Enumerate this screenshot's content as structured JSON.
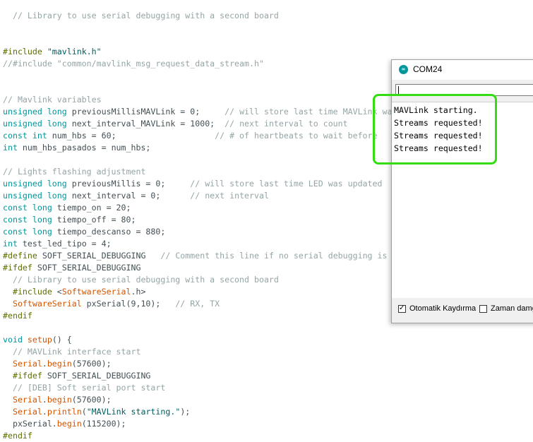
{
  "editor": {
    "code_lines": [
      [
        [
          "cm",
          "  // Library to use serial debugging with a second board"
        ]
      ],
      [
        [
          "pp",
          "#include "
        ],
        [
          "str",
          "\"mavlink.h\""
        ]
      ],
      [
        [
          "cm",
          "//#include \"common/mavlink_msg_request_data_stream.h\""
        ]
      ],
      [
        [
          "cm",
          "// Mavlink variables"
        ]
      ],
      [
        [
          "kw",
          "unsigned long"
        ],
        [
          "tx",
          " previousMillisMAVLink = 0;     "
        ],
        [
          "cm",
          "// will store last time MAVLink was"
        ]
      ],
      [
        [
          "kw",
          "unsigned long"
        ],
        [
          "tx",
          " next_interval_MAVLink = 1000;  "
        ],
        [
          "cm",
          "// next interval to count"
        ]
      ],
      [
        [
          "kw",
          "const int"
        ],
        [
          "tx",
          " num_hbs = 60;                    "
        ],
        [
          "cm",
          "// # of heartbeats to wait before"
        ]
      ],
      [
        [
          "kw",
          "int"
        ],
        [
          "tx",
          " num_hbs_pasados = num_hbs;"
        ]
      ],
      [
        [
          "cm",
          "// Lights flashing adjustment"
        ]
      ],
      [
        [
          "kw",
          "unsigned long"
        ],
        [
          "tx",
          " previousMillis = 0;     "
        ],
        [
          "cm",
          "// will store last time LED was updated"
        ]
      ],
      [
        [
          "kw",
          "unsigned long"
        ],
        [
          "tx",
          " next_interval = 0;      "
        ],
        [
          "cm",
          "// next interval"
        ]
      ],
      [
        [
          "kw",
          "const long"
        ],
        [
          "tx",
          " tiempo_on = 20;"
        ]
      ],
      [
        [
          "kw",
          "const long"
        ],
        [
          "tx",
          " tiempo_off = 80;"
        ]
      ],
      [
        [
          "kw",
          "const long"
        ],
        [
          "tx",
          " tiempo_descanso = 880;"
        ]
      ],
      [
        [
          "kw",
          "int"
        ],
        [
          "tx",
          " test_led_tipo = 4;"
        ]
      ],
      [
        [
          "pp",
          "#define"
        ],
        [
          "tx",
          " SOFT_SERIAL_DEBUGGING   "
        ],
        [
          "cm",
          "// Comment this line if no serial debugging is"
        ]
      ],
      [
        [
          "pp",
          "#ifdef"
        ],
        [
          "tx",
          " SOFT_SERIAL_DEBUGGING"
        ]
      ],
      [
        [
          "cm",
          "  // Library to use serial debugging with a second board"
        ]
      ],
      [
        [
          "pp",
          "  #include "
        ],
        [
          "tx",
          "<"
        ],
        [
          "fn",
          "SoftwareSerial"
        ],
        [
          "tx",
          ".h>"
        ]
      ],
      [
        [
          "fn",
          "  SoftwareSerial"
        ],
        [
          "tx",
          " pxSerial(9,10);   "
        ],
        [
          "cm",
          "// RX, TX"
        ]
      ],
      [
        [
          "pp",
          "#endif"
        ]
      ],
      [
        [
          "kw",
          "void"
        ],
        [
          "tx",
          " "
        ],
        [
          "fn",
          "setup"
        ],
        [
          "tx",
          "() {"
        ]
      ],
      [
        [
          "cm",
          "  // MAVLink interface start"
        ]
      ],
      [
        [
          "fn",
          "  Serial"
        ],
        [
          "tx",
          "."
        ],
        [
          "fn",
          "begin"
        ],
        [
          "tx",
          "(57600);"
        ]
      ],
      [
        [
          "pp",
          "  #ifdef"
        ],
        [
          "tx",
          " SOFT_SERIAL_DEBUGGING"
        ]
      ],
      [
        [
          "cm",
          "  // [DEB] Soft serial port start"
        ]
      ],
      [
        [
          "fn",
          "  Serial"
        ],
        [
          "tx",
          "."
        ],
        [
          "fn",
          "begin"
        ],
        [
          "tx",
          "(57600);"
        ]
      ],
      [
        [
          "fn",
          "  Serial"
        ],
        [
          "tx",
          "."
        ],
        [
          "fn",
          "println"
        ],
        [
          "tx",
          "("
        ],
        [
          "str",
          "\"MAVLink starting.\""
        ],
        [
          "tx",
          ");"
        ]
      ],
      [
        [
          "tx",
          "  pxSerial."
        ],
        [
          "fn",
          "begin"
        ],
        [
          "tx",
          "(115200);"
        ]
      ],
      [
        [
          "pp",
          "#endif"
        ]
      ]
    ]
  },
  "serial_monitor": {
    "title": "COM24",
    "app_icon": "arduino-infinity-icon",
    "input_value": "",
    "output_lines": [
      "MAVLink starting.",
      "Streams requested!",
      "Streams requested!",
      "Streams requested!"
    ],
    "autoscroll_label": "Otomatik Kaydırma",
    "autoscroll_checked": true,
    "timestamp_label": "Zaman damg",
    "timestamp_checked": false
  },
  "colors": {
    "keyword": "#00979c",
    "function": "#d35400",
    "comment": "#95a5a6",
    "annotation": "#33dd11"
  }
}
